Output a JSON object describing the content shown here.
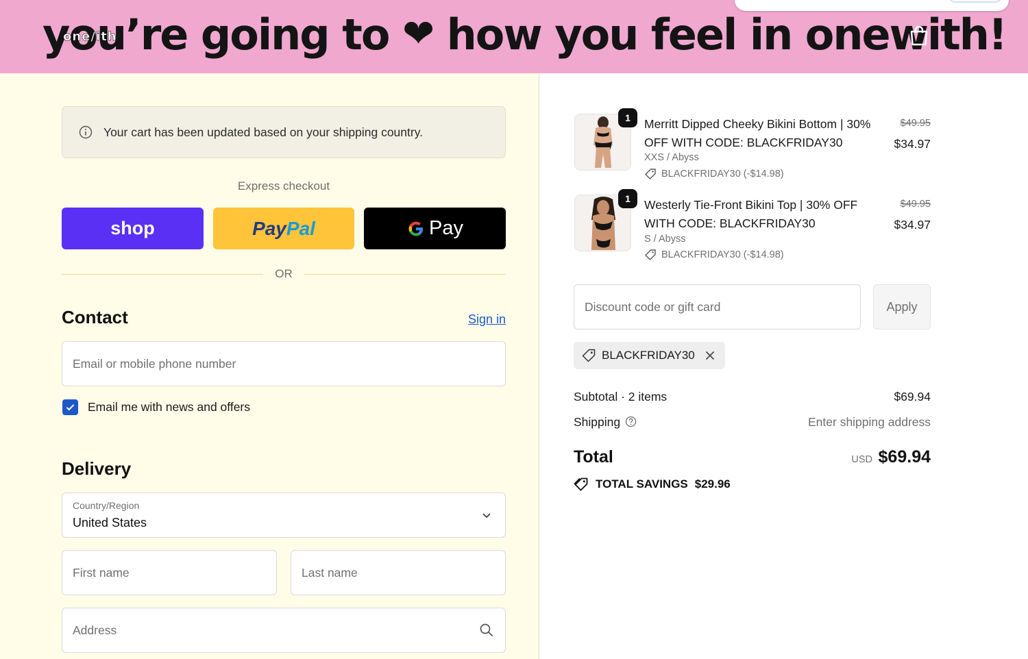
{
  "banner": {
    "headline_part1": "you’re going to",
    "headline_heart": "❤",
    "headline_part2": "how you feel in onewith!",
    "overlay_text": "one/ith"
  },
  "notice": {
    "text": "Your cart has been updated based on your shipping country."
  },
  "express": {
    "label": "Express checkout",
    "shop_label": "shop",
    "paypal_part1": "Pay",
    "paypal_part2": "Pal",
    "gpay_label": "Pay"
  },
  "or_label": "OR",
  "contact": {
    "title": "Contact",
    "signin_label": "Sign in",
    "email_placeholder": "Email or mobile phone number",
    "newsletter_label": "Email me with news and offers",
    "newsletter_checked": true
  },
  "delivery": {
    "title": "Delivery",
    "country_label": "Country/Region",
    "country_value": "United States",
    "first_name_placeholder": "First name",
    "last_name_placeholder": "Last name",
    "address_placeholder": "Address"
  },
  "cart": {
    "items": [
      {
        "qty": "1",
        "name": "Merritt Dipped Cheeky Bikini Bottom | 30% OFF WITH CODE: BLACKFRIDAY30",
        "variant": "XXS / Abyss",
        "discount": "BLACKFRIDAY30 (-$14.98)",
        "price_old": "$49.95",
        "price_new": "$34.97"
      },
      {
        "qty": "1",
        "name": "Westerly Tie-Front Bikini Top | 30% OFF WITH CODE: BLACKFRIDAY30",
        "variant": "S / Abyss",
        "discount": "BLACKFRIDAY30 (-$14.98)",
        "price_old": "$49.95",
        "price_new": "$34.97"
      }
    ],
    "discount_placeholder": "Discount code or gift card",
    "apply_label": "Apply",
    "applied_code": "BLACKFRIDAY30",
    "subtotal_label": "Subtotal · 2 items",
    "subtotal_value": "$69.94",
    "shipping_label": "Shipping",
    "shipping_value": "Enter shipping address",
    "total_label": "Total",
    "total_currency": "USD",
    "total_value": "$69.94",
    "savings_label": "TOTAL SAVINGS",
    "savings_value": "$29.96"
  },
  "colors": {
    "banner_bg": "#f0a8cf",
    "left_bg": "#fffde8",
    "shop_purple": "#5a31f4",
    "paypal_yellow": "#ffc439",
    "link_blue": "#1c58c9"
  }
}
